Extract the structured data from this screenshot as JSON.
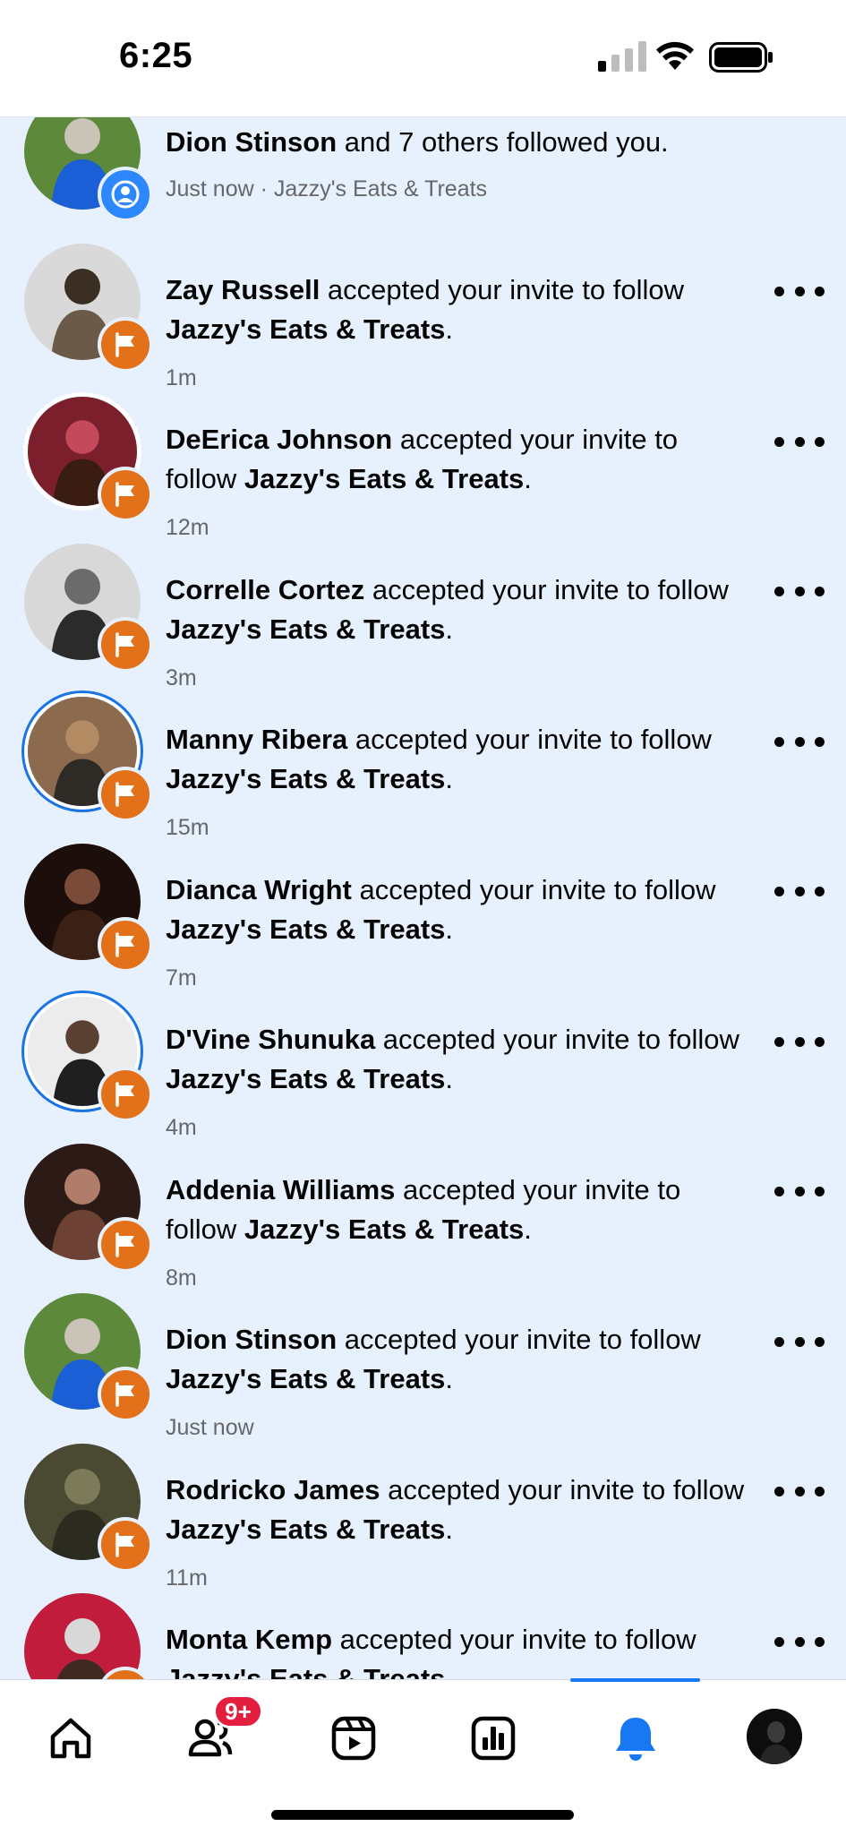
{
  "status": {
    "time": "6:25"
  },
  "colors": {
    "accent": "#1877f2",
    "feed_bg": "#e7f0fd",
    "page_badge": "#e27119",
    "follow_badge": "#2d88ff",
    "alert": "#e41e3f"
  },
  "notifications": [
    {
      "name": "Dion Stinson",
      "text": " and 7 others followed you.",
      "page": "",
      "tail": "",
      "meta": "Just now · Jazzy's Eats & Treats",
      "badge_icon": "person-icon"
    },
    {
      "name": "Zay Russell",
      "text": " accepted your invite to follow ",
      "page": "Jazzy's Eats & Treats",
      "tail": ".",
      "meta": "1m",
      "badge_icon": "flag-icon"
    },
    {
      "name": "DeErica Johnson",
      "text": " accepted your invite to follow ",
      "page": "Jazzy's Eats & Treats",
      "tail": ".",
      "meta": "12m",
      "badge_icon": "flag-icon"
    },
    {
      "name": "Correlle Cortez",
      "text": " accepted your invite to follow ",
      "page": "Jazzy's Eats & Treats",
      "tail": ".",
      "meta": "3m",
      "badge_icon": "flag-icon"
    },
    {
      "name": "Manny Ribera",
      "text": " accepted your invite to follow ",
      "page": "Jazzy's Eats & Treats",
      "tail": ".",
      "meta": "15m",
      "badge_icon": "flag-icon"
    },
    {
      "name": "Dianca Wright",
      "text": " accepted your invite to follow ",
      "page": "Jazzy's Eats & Treats",
      "tail": ".",
      "meta": "7m",
      "badge_icon": "flag-icon"
    },
    {
      "name": "D'Vine Shunuka",
      "text": " accepted your invite to follow ",
      "page": "Jazzy's Eats & Treats",
      "tail": ".",
      "meta": "4m",
      "badge_icon": "flag-icon"
    },
    {
      "name": "Addenia Williams",
      "text": " accepted your invite to follow ",
      "page": "Jazzy's Eats & Treats",
      "tail": ".",
      "meta": "8m",
      "badge_icon": "flag-icon"
    },
    {
      "name": "Dion Stinson",
      "text": " accepted your invite to follow ",
      "page": "Jazzy's Eats & Treats",
      "tail": ".",
      "meta": "Just now",
      "badge_icon": "flag-icon"
    },
    {
      "name": "Rodricko James",
      "text": " accepted your invite to follow ",
      "page": "Jazzy's Eats & Treats",
      "tail": ".",
      "meta": "11m",
      "badge_icon": "flag-icon"
    },
    {
      "name": "Monta Kemp",
      "text": " accepted your invite to follow ",
      "page": "Jazzy's Eats & Treats",
      "tail": ".",
      "meta": "",
      "badge_icon": "flag-icon"
    }
  ],
  "nav": {
    "items": [
      "home-icon",
      "friends-icon",
      "video-icon",
      "insights-icon",
      "notifications-icon",
      "profile-avatar"
    ],
    "active": "notifications-icon",
    "friends_badge": "9+"
  }
}
